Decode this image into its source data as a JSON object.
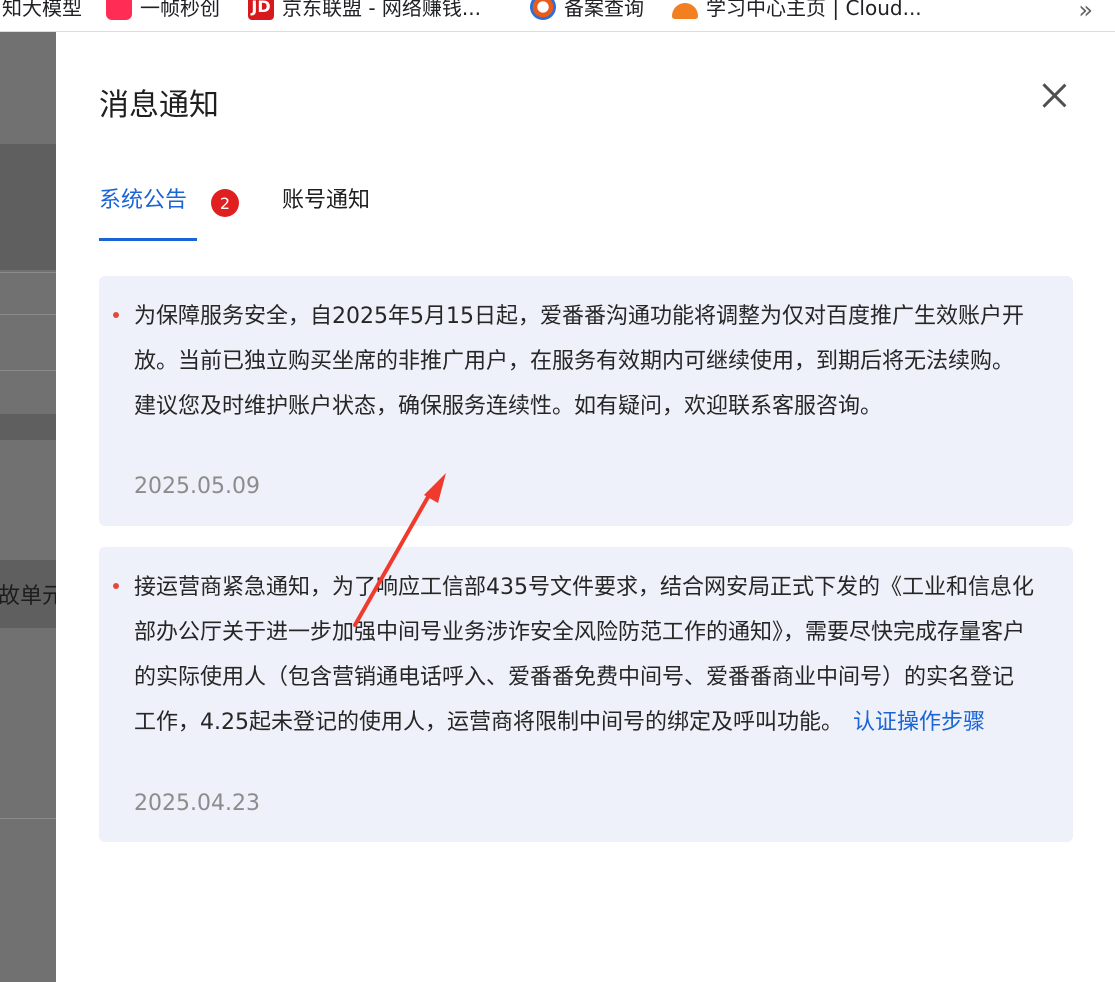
{
  "bookmarks": {
    "items": [
      {
        "label": "知大模型"
      },
      {
        "label": "一帧秒创"
      },
      {
        "label": "京东联盟 - 网络赚钱..."
      },
      {
        "label": "备案查询"
      },
      {
        "label": "学习中心主页 | Cloud..."
      }
    ],
    "more": "»",
    "jd_logo": "JD"
  },
  "background": {
    "partial_text": "故单元"
  },
  "drawer": {
    "title": "消息通知",
    "tabs": [
      {
        "label": "系统公告",
        "badge": "2",
        "active": true
      },
      {
        "label": "账号通知",
        "active": false
      }
    ],
    "notices": [
      {
        "text": "为保障服务安全，自2025年5月15日起，爱番番沟通功能将调整为仅对百度推广生效账户开放。当前已独立购买坐席的非推广用户，在服务有效期内可继续使用，到期后将无法续购。建议您及时维护账户状态，确保服务连续性。如有疑问，欢迎联系客服咨询。",
        "date": "2025.05.09"
      },
      {
        "text": "接运营商紧急通知，为了响应工信部435号文件要求，结合网安局正式下发的《工业和信息化部办公厅关于进一步加强中间号业务涉诈安全风险防范工作的通知》，需要尽快完成存量客户的实际使用人（包含营销通电话呼入、爱番番免费中间号、爱番番商业中间号）的实名登记工作，4.25起未登记的使用人，运营商将限制中间号的绑定及呼叫功能。",
        "link": "认证操作步骤",
        "date": "2025.04.23"
      }
    ]
  },
  "colors": {
    "accent": "#1a64d6",
    "badge": "#e02020",
    "notice_bg": "#eef1f9",
    "annotation_arrow": "#f03a2e"
  }
}
